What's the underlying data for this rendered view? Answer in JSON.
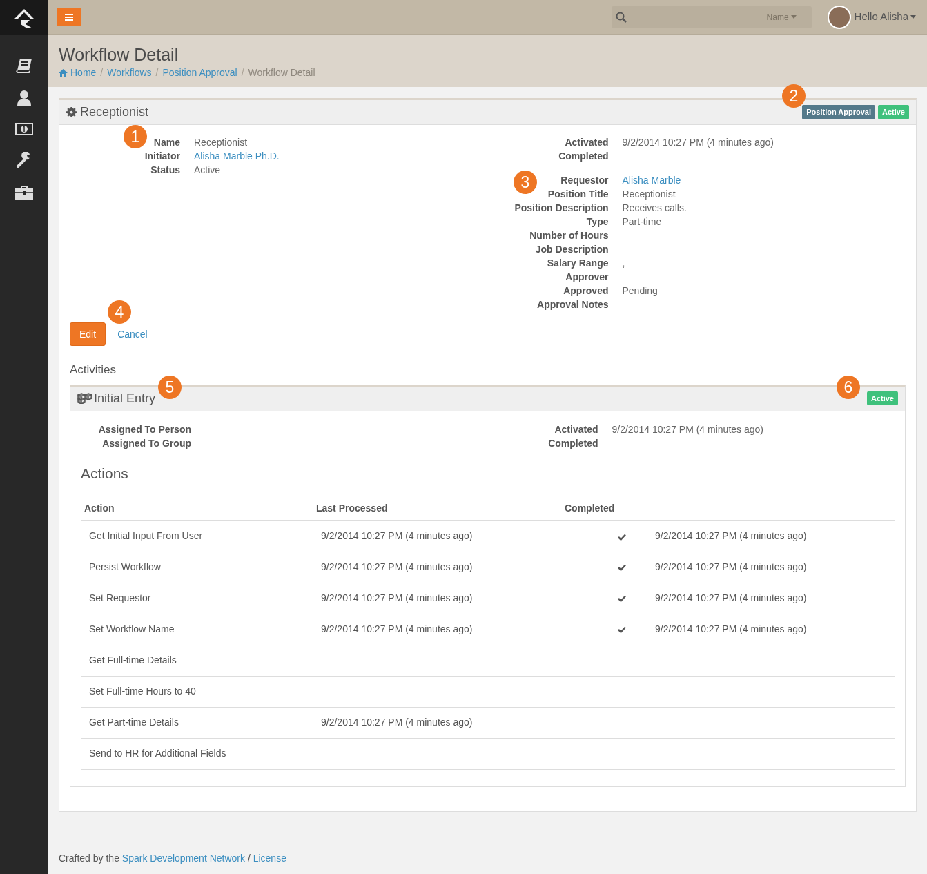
{
  "topbar": {
    "search": {
      "scope": "Name"
    },
    "user": {
      "greeting": "Hello Alisha"
    }
  },
  "page": {
    "title": "Workflow Detail",
    "separator": "/",
    "breadcrumbs": [
      {
        "label": "Home",
        "link": true,
        "kind": "home"
      },
      {
        "label": "Workflows",
        "link": true
      },
      {
        "label": "Position Approval",
        "link": true
      },
      {
        "label": "Workflow Detail",
        "link": false
      }
    ]
  },
  "workflow": {
    "title": "Receptionist",
    "marker": "1",
    "badge_marker": "2",
    "details_marker": "3",
    "buttons_marker": "4",
    "badges": [
      {
        "label": "Position Approval",
        "color": "#54798a"
      },
      {
        "label": "Active",
        "color": "#3fc17c"
      }
    ],
    "left_fields": [
      {
        "label": "Name",
        "value": "Receptionist",
        "link": false
      },
      {
        "label": "Initiator",
        "value": "Alisha Marble Ph.D.",
        "link": true
      },
      {
        "label": "Status",
        "value": "Active",
        "link": false
      }
    ],
    "right_fields": [
      {
        "label": "Activated",
        "value": "9/2/2014 10:27 PM (4 minutes ago)",
        "link": false
      },
      {
        "label": "Completed"
      }
    ],
    "attributes": [
      {
        "label": "Requestor",
        "value": "Alisha Marble",
        "link": true
      },
      {
        "label": "Position Title",
        "value": "Receptionist",
        "link": false
      },
      {
        "label": "Position Description",
        "value": "Receives calls.",
        "link": false
      },
      {
        "label": "Type",
        "value": "Part-time",
        "link": false
      },
      {
        "label": "Number of Hours"
      },
      {
        "label": "Job Description"
      },
      {
        "label": "Salary Range",
        "value": ",",
        "link": false
      },
      {
        "label": "Approver"
      },
      {
        "label": "Approved",
        "value": "Pending",
        "link": false
      },
      {
        "label": "Approval Notes"
      }
    ],
    "buttons": [
      {
        "label": "Edit",
        "kind": "primary"
      },
      {
        "label": "Cancel",
        "kind": "link"
      }
    ]
  },
  "activities": {
    "heading": "Activities",
    "activity": {
      "title": "Initial Entry",
      "marker": "5",
      "badge_marker": "6",
      "badge": {
        "label": "Active",
        "color": "#3fc17c"
      },
      "left_fields": [
        {
          "label": "Assigned To Person"
        },
        {
          "label": "Assigned To Group"
        }
      ],
      "right_fields": [
        {
          "label": "Activated",
          "value": "9/2/2014 10:27 PM (4 minutes ago)",
          "link": false
        },
        {
          "label": "Completed"
        }
      ],
      "actions": {
        "heading": "Actions",
        "columns": [
          "Action",
          "Last Processed",
          "Completed"
        ],
        "rows": [
          {
            "action": "Get Initial Input From User",
            "last_processed": "9/2/2014 10:27 PM (4 minutes ago)",
            "completed": true,
            "completed_at": "9/2/2014 10:27 PM (4 minutes ago)"
          },
          {
            "action": "Persist Workflow",
            "last_processed": "9/2/2014 10:27 PM (4 minutes ago)",
            "completed": true,
            "completed_at": "9/2/2014 10:27 PM (4 minutes ago)"
          },
          {
            "action": "Set Requestor",
            "last_processed": "9/2/2014 10:27 PM (4 minutes ago)",
            "completed": true,
            "completed_at": "9/2/2014 10:27 PM (4 minutes ago)"
          },
          {
            "action": "Set Workflow Name",
            "last_processed": "9/2/2014 10:27 PM (4 minutes ago)",
            "completed": true,
            "completed_at": "9/2/2014 10:27 PM (4 minutes ago)"
          },
          {
            "action": "Get Full-time Details",
            "completed": false
          },
          {
            "action": "Set Full-time Hours to 40",
            "completed": false
          },
          {
            "action": "Get Part-time Details",
            "last_processed": "9/2/2014 10:27 PM (4 minutes ago)",
            "completed": false
          },
          {
            "action": "Send to HR for Additional Fields",
            "completed": false
          }
        ]
      }
    }
  },
  "footer": {
    "prefix": "Crafted by the ",
    "link": "Spark Development Network",
    "separator": " / ",
    "license": "License"
  }
}
